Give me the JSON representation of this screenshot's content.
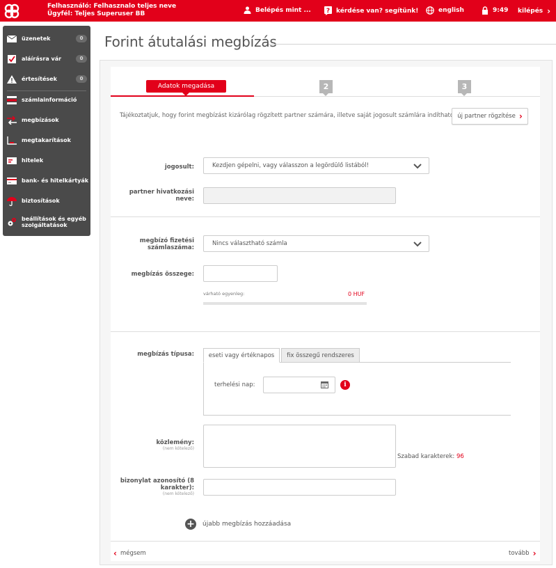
{
  "header": {
    "user_line1": "Felhasználó: Felhasznalo teljes neve",
    "user_line2": "Ügyfél: Teljes Superuser BB",
    "login_as": "Belépés mint ...",
    "help": "kérdése van? segítünk!",
    "language": "english",
    "time": "9:49",
    "logout": "kilépés"
  },
  "sidebar": {
    "items": [
      {
        "label": "üzenetek",
        "badge": "0"
      },
      {
        "label": "aláírásra vár",
        "badge": "0"
      },
      {
        "label": "értesítések",
        "badge": "0"
      },
      {
        "label": "számlainformáció"
      },
      {
        "label": "megbízások"
      },
      {
        "label": "megtakarítások"
      },
      {
        "label": "hitelek"
      },
      {
        "label": "bank- és hitelkártyák"
      },
      {
        "label": "biztosítások"
      },
      {
        "label": "beállítások és egyéb szolgáltatások"
      }
    ]
  },
  "page": {
    "title": "Forint átutalási megbízás"
  },
  "steps": {
    "active_label": "Adatok megadása",
    "step2": "2",
    "step3": "3"
  },
  "info": {
    "text": "Tájékoztatjuk, hogy forint megbízást kizárólag rögzített partner számára, illetve saját jogosult számlára indítható.",
    "new_partner_button": "új partner rögzítése"
  },
  "form": {
    "beneficiary_label": "jogosult:",
    "beneficiary_value": "Kezdjen gépelni, vagy válasszon a legördülő listából!",
    "partner_ref_label": "partner hivatkozási neve:",
    "payer_account_label": "megbízó fizetési számlaszáma:",
    "payer_account_value": "Nincs választható számla",
    "amount_label": "megbízás összege:",
    "expected_balance_label": "várható egyenleg:",
    "expected_balance_value": "0 HUF",
    "order_type_label": "megbízás típusa:",
    "tab_single": "eseti vagy értéknapos",
    "tab_recurring": "fix összegű rendszeres",
    "debit_date_label": "terhelési nap:",
    "info_icon_text": "i",
    "notice_label": "közlemény:",
    "notice_sub": "(nem kötelező)",
    "free_chars_label": "Szabad karakterek:",
    "free_chars_value": "96",
    "doc_id_label": "bizonylat azonosító (8 karakter):",
    "doc_id_sub": "(nem kötelező)",
    "add_more": "újabb megbízás hozzáadása",
    "cancel": "mégsem",
    "next": "tovább"
  },
  "colors": {
    "brand": "#e2001a",
    "sidebar_bg": "#4a4a4a"
  }
}
